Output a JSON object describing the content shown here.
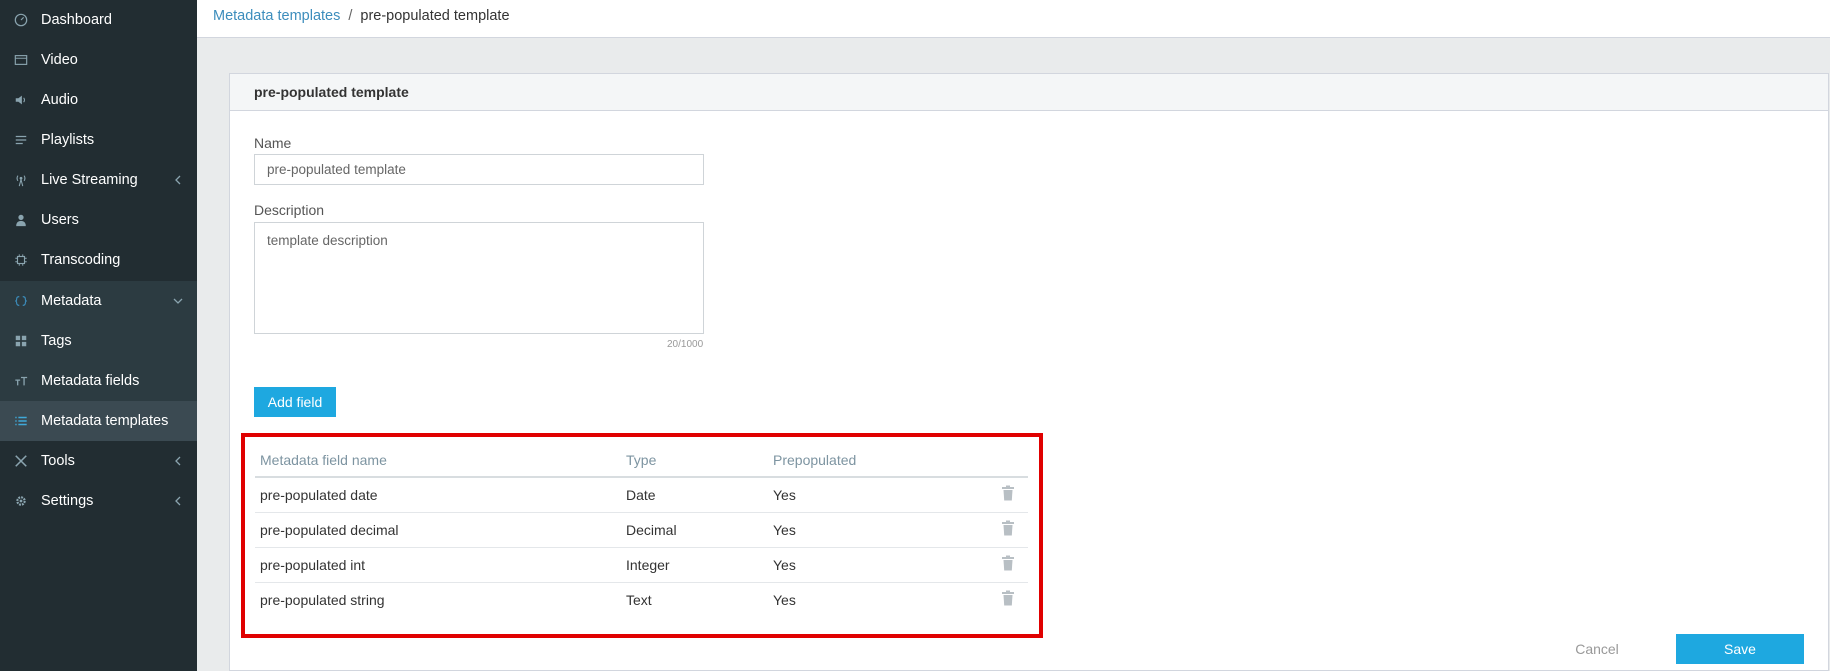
{
  "sidebar": {
    "items": [
      {
        "label": "Dashboard",
        "icon": "dashboard-icon"
      },
      {
        "label": "Video",
        "icon": "video-icon"
      },
      {
        "label": "Audio",
        "icon": "audio-icon"
      },
      {
        "label": "Playlists",
        "icon": "playlist-icon"
      },
      {
        "label": "Live Streaming",
        "icon": "broadcast-icon",
        "expandable": true
      },
      {
        "label": "Users",
        "icon": "user-icon"
      },
      {
        "label": "Transcoding",
        "icon": "chip-icon"
      },
      {
        "label": "Metadata",
        "icon": "code-icon",
        "expanded": true
      },
      {
        "label": "Tags",
        "icon": "tags-icon"
      },
      {
        "label": "Metadata fields",
        "icon": "text-field-icon"
      },
      {
        "label": "Metadata templates",
        "icon": "list-icon",
        "active": true
      },
      {
        "label": "Tools",
        "icon": "tools-icon",
        "expandable": true
      },
      {
        "label": "Settings",
        "icon": "gear-icon",
        "expandable": true
      }
    ]
  },
  "breadcrumb": {
    "parent": "Metadata templates",
    "separator": "/",
    "current": "pre-populated template"
  },
  "panel": {
    "title": "pre-populated template"
  },
  "form": {
    "name_label": "Name",
    "name_value": "pre-populated template",
    "description_label": "Description",
    "description_value": "template description",
    "char_count": "20/1000",
    "add_field_label": "Add field"
  },
  "table": {
    "headers": {
      "name": "Metadata field name",
      "type": "Type",
      "prepopulated": "Prepopulated"
    },
    "rows": [
      {
        "name": "pre-populated date",
        "type": "Date",
        "prepopulated": "Yes"
      },
      {
        "name": "pre-populated decimal",
        "type": "Decimal",
        "prepopulated": "Yes"
      },
      {
        "name": "pre-populated int",
        "type": "Integer",
        "prepopulated": "Yes"
      },
      {
        "name": "pre-populated string",
        "type": "Text",
        "prepopulated": "Yes"
      }
    ]
  },
  "actions": {
    "cancel_label": "Cancel",
    "save_label": "Save"
  },
  "colors": {
    "sidebar_bg": "#222d32",
    "accent": "#1ea8e0",
    "highlight": "#e00000",
    "link": "#3c8dbc"
  }
}
